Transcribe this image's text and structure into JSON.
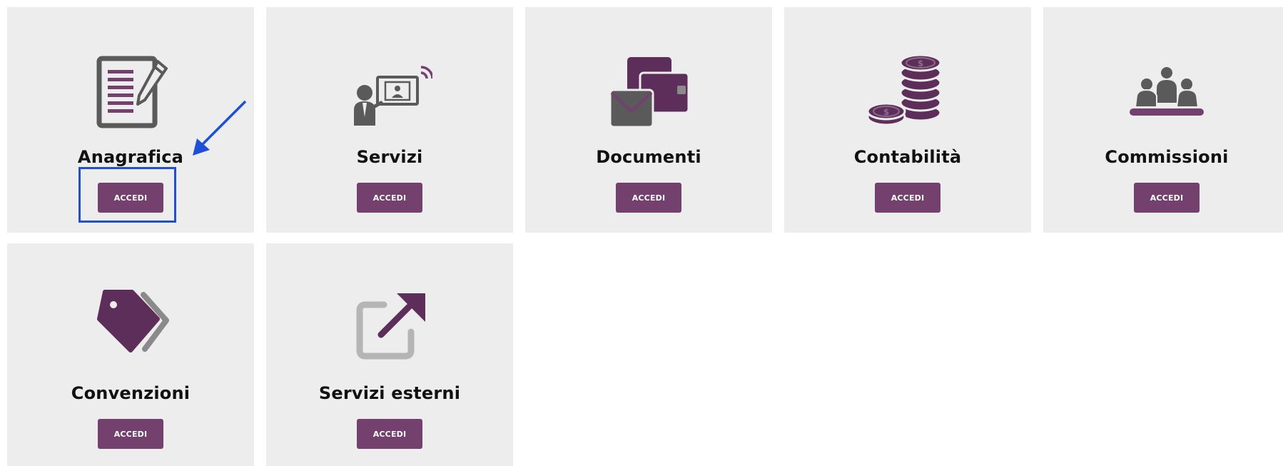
{
  "tiles": [
    {
      "title": "Anagrafica",
      "button_label": "ACCEDI",
      "icon": "form-pencil-icon"
    },
    {
      "title": "Servizi",
      "button_label": "ACCEDI",
      "icon": "presenter-screen-icon"
    },
    {
      "title": "Documenti",
      "button_label": "ACCEDI",
      "icon": "documents-envelope-icon"
    },
    {
      "title": "Contabilità",
      "button_label": "ACCEDI",
      "icon": "coins-stack-icon"
    },
    {
      "title": "Commissioni",
      "button_label": "ACCEDI",
      "icon": "people-group-icon"
    },
    {
      "title": "Convenzioni",
      "button_label": "ACCEDI",
      "icon": "tag-icon"
    },
    {
      "title": "Servizi esterni",
      "button_label": "ACCEDI",
      "icon": "external-link-icon"
    }
  ],
  "colors": {
    "tile_background": "#ededed",
    "accent_purple": "#74416f",
    "icon_gray": "#5a5a5a",
    "annotation_blue": "#1f4fd6"
  }
}
